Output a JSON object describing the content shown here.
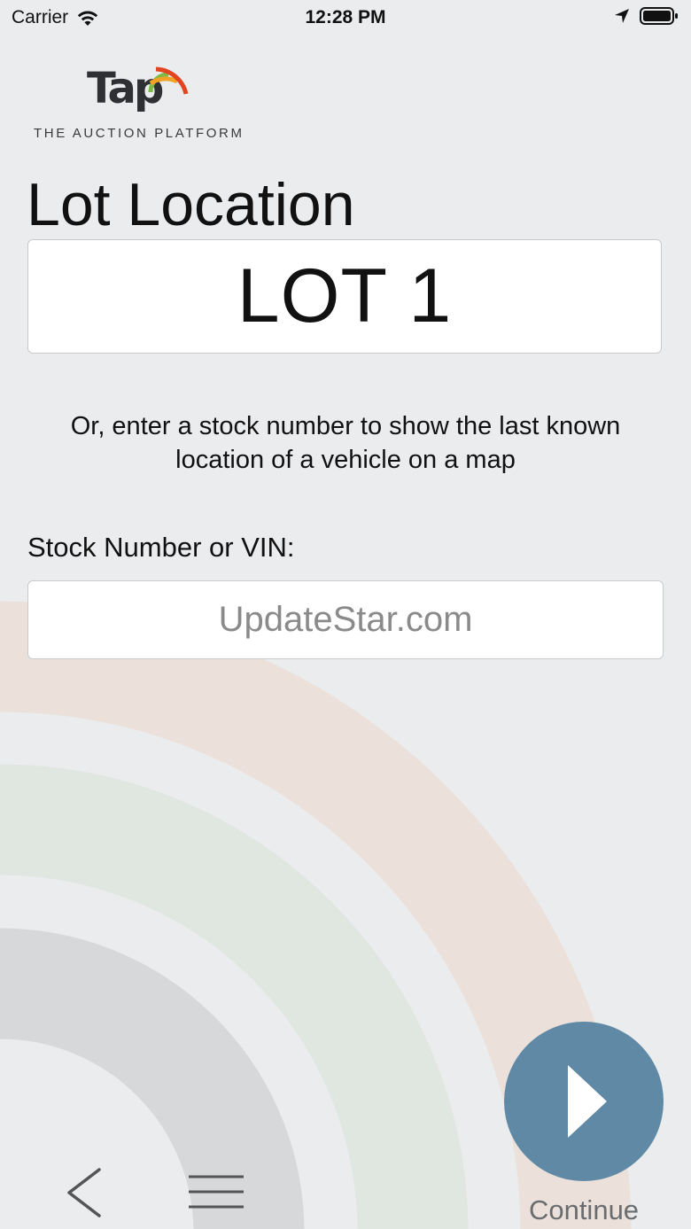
{
  "status_bar": {
    "carrier": "Carrier",
    "time": "12:28 PM",
    "icons": [
      "wifi-icon",
      "location-arrow-icon",
      "battery-icon"
    ]
  },
  "logo": {
    "wordmark": "Tap",
    "tagline": "THE AUCTION PLATFORM",
    "colors": [
      "#e2451f",
      "#f0a327",
      "#7fba48"
    ]
  },
  "page": {
    "title": "Lot Location",
    "lot_value": "LOT 1",
    "instructions": "Or, enter a stock number to show the last known location of a vehicle on a map",
    "stock_label": "Stock Number or VIN:",
    "stock_value": "",
    "stock_placeholder": "UpdateStar.com"
  },
  "bottom_bar": {
    "back_icon": "chevron-left-icon",
    "menu_icon": "hamburger-menu-icon",
    "continue_icon": "play-icon",
    "continue_label": "Continue"
  },
  "colors": {
    "background": "#eaecee",
    "continue_button": "#5f89a4",
    "arc_orange": "#ece1da",
    "arc_green": "#e0e6e0",
    "arc_gray": "#d6d8da"
  }
}
